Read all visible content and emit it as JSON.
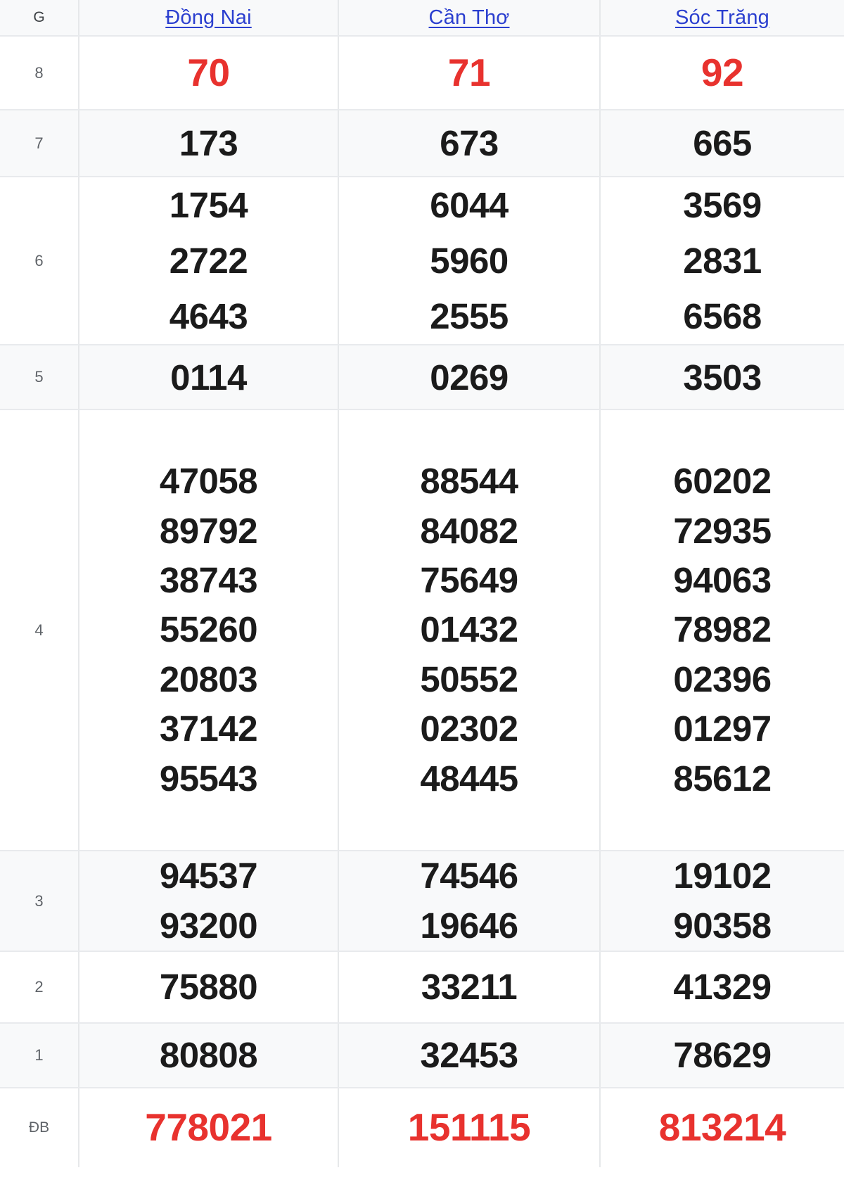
{
  "table": {
    "header": {
      "prize_col_label": "G",
      "provinces": [
        {
          "name": "Đồng Nai"
        },
        {
          "name": "Cần Thơ"
        },
        {
          "name": "Sóc Trăng"
        }
      ]
    },
    "colors": {
      "link": "#2b3fcf",
      "highlight_red": "#e8322e",
      "number_black": "#1b1b1b",
      "row_stripe": "#f8f9fa",
      "row_plain": "#ffffff",
      "border": "#e8eaed"
    },
    "rows": [
      {
        "label": "8",
        "style": "hot",
        "cells": [
          [
            "70"
          ],
          [
            "71"
          ],
          [
            "92"
          ]
        ]
      },
      {
        "label": "7",
        "style": "normal",
        "cells": [
          [
            "173"
          ],
          [
            "673"
          ],
          [
            "665"
          ]
        ]
      },
      {
        "label": "6",
        "style": "normal",
        "cells": [
          [
            "1754",
            "2722",
            "4643"
          ],
          [
            "6044",
            "5960",
            "2555"
          ],
          [
            "3569",
            "2831",
            "6568"
          ]
        ]
      },
      {
        "label": "5",
        "style": "normal",
        "cells": [
          [
            "0114"
          ],
          [
            "0269"
          ],
          [
            "3503"
          ]
        ]
      },
      {
        "label": "4",
        "style": "normal",
        "cells": [
          [
            "47058",
            "89792",
            "38743",
            "55260",
            "20803",
            "37142",
            "95543"
          ],
          [
            "88544",
            "84082",
            "75649",
            "01432",
            "50552",
            "02302",
            "48445"
          ],
          [
            "60202",
            "72935",
            "94063",
            "78982",
            "02396",
            "01297",
            "85612"
          ]
        ]
      },
      {
        "label": "3",
        "style": "normal",
        "cells": [
          [
            "94537",
            "93200"
          ],
          [
            "74546",
            "19646"
          ],
          [
            "19102",
            "90358"
          ]
        ]
      },
      {
        "label": "2",
        "style": "normal",
        "cells": [
          [
            "75880"
          ],
          [
            "33211"
          ],
          [
            "41329"
          ]
        ]
      },
      {
        "label": "1",
        "style": "normal",
        "cells": [
          [
            "80808"
          ],
          [
            "32453"
          ],
          [
            "78629"
          ]
        ]
      },
      {
        "label": "ĐB",
        "style": "special",
        "cells": [
          [
            "778021"
          ],
          [
            "151115"
          ],
          [
            "813214"
          ]
        ]
      }
    ]
  }
}
